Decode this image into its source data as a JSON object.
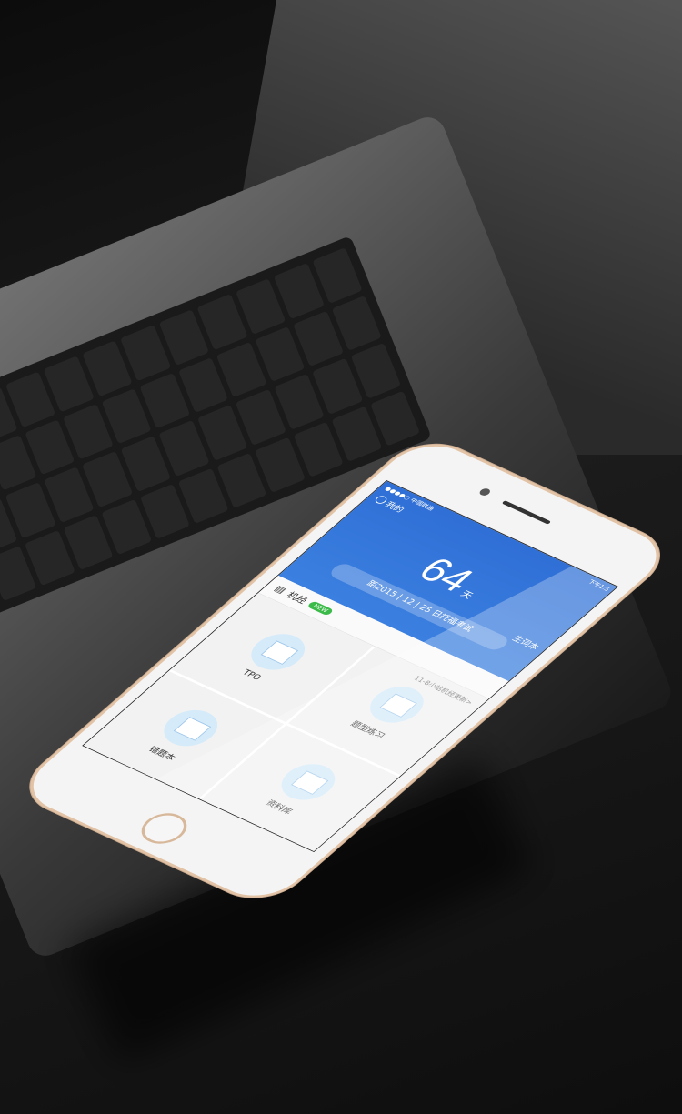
{
  "status": {
    "carrier": "●●●●○ 中国联通",
    "time": "下午1:5"
  },
  "header": {
    "me_label": "我的",
    "days": "64",
    "days_unit": "天",
    "exam_date": "距2015 | 12 | 25 日托福考试",
    "vocab_label": "生词本"
  },
  "section": {
    "title": "机经",
    "badge": "NEW",
    "update": "11-8小站机经更新>"
  },
  "grid": [
    {
      "label": "TPO",
      "icon": "tpo-document-icon"
    },
    {
      "label": "题型练习",
      "icon": "calendar-practice-icon"
    },
    {
      "label": "错题本",
      "icon": "wrong-notebook-icon"
    },
    {
      "label": "资料库",
      "icon": "library-icon"
    }
  ],
  "colors": {
    "header_blue": "#2f6fd6",
    "badge_green": "#3dbb4a",
    "phone_gold": "#e3c3a6"
  }
}
